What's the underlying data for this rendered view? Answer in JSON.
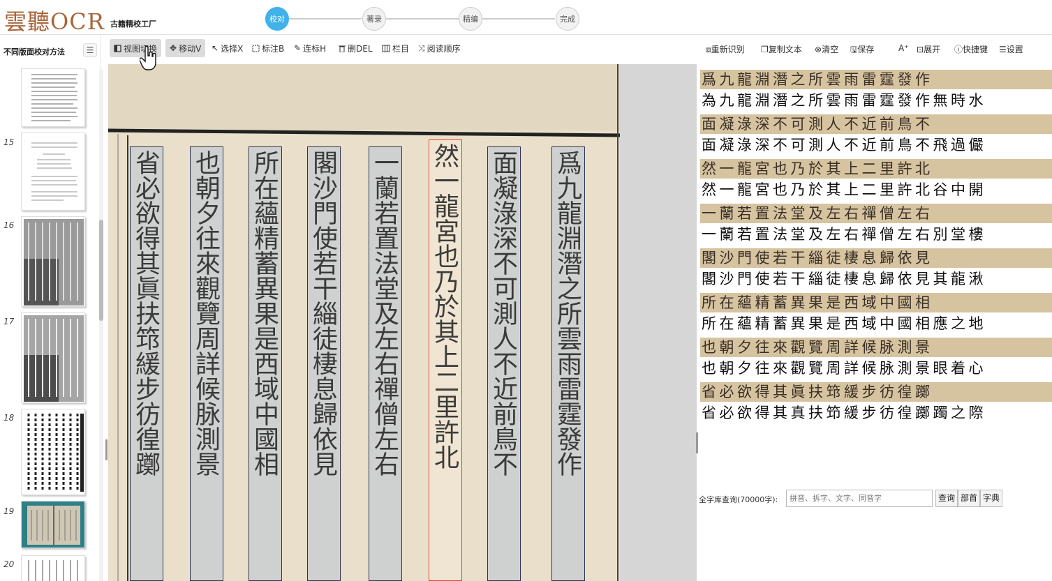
{
  "app": {
    "logo": "雲聽OCR",
    "subtitle": "古籍精校工厂"
  },
  "steps": [
    "校对",
    "著录",
    "精编",
    "完成"
  ],
  "left": {
    "doc_title": "不同版面校对方法",
    "menu_icon": "☰",
    "pages": [
      "15",
      "16",
      "17",
      "18",
      "19",
      "20"
    ]
  },
  "toolbar": [
    {
      "label": "视图切换",
      "icon": "view-switch-icon"
    },
    {
      "label": "移动V",
      "icon": "move-icon"
    },
    {
      "label": "选择X",
      "icon": "select-icon"
    },
    {
      "label": "标注B",
      "icon": "annotate-icon"
    },
    {
      "label": "连标H",
      "icon": "pen-icon"
    },
    {
      "label": "删DEL",
      "icon": "trash-icon"
    },
    {
      "label": "栏目",
      "icon": "column-icon"
    },
    {
      "label": "阅读顺序",
      "icon": "order-icon"
    }
  ],
  "right_toolbar": [
    {
      "label": "重新识别",
      "icon": "rerecognize-icon"
    },
    {
      "label": "复制文本",
      "icon": "copy-icon"
    },
    {
      "label": "清空",
      "icon": "clear-icon"
    },
    {
      "label": "保存",
      "icon": "save-icon"
    },
    {
      "label": "A⁺",
      "icon": "font-size-icon"
    },
    {
      "label": "展开",
      "icon": "expand-icon"
    },
    {
      "label": "快捷键",
      "icon": "info-icon"
    },
    {
      "label": "设置",
      "icon": "settings-icon"
    }
  ],
  "columns": [
    "爲九龍淵潛之所雲雨雷霆發作",
    "面凝淥深不可測人不近前鳥不",
    "然一龍宮也乃於其上二里許北",
    "一蘭若置法堂及左右禪僧左右",
    "閣沙門使若干緇徒棲息歸依見",
    "所在蘊精蓄異果是西域中國相",
    "也朝夕往來觀覽周詳候脉測景",
    "省必欲得其眞扶筇緩步彷徨躑"
  ],
  "lines": [
    "為九龍淵潛之所雲雨雷霆發作無時水",
    "面凝淥深不可測人不近前鳥不飛過儼",
    "然一龍宮也乃於其上二里許北谷中開",
    "一蘭若置法堂及左右禪僧左右別堂樓",
    "閣沙門使若干緇徒棲息歸依見其龍湫",
    "所在蘊精蓄異果是西域中國相應之地",
    "也朝夕往來觀覽周詳候脉測景眼着心",
    "省必欲得其真扶笻緩步彷徨躑躅之際"
  ],
  "search": {
    "label": "全字库查询(70000字):",
    "placeholder": "拼音、拆字、文字、同音字",
    "query_btn": "查询",
    "radical_btn": "部首",
    "dict_btn": "字典"
  },
  "colors": {
    "brand": "#a8653a",
    "accent": "#3fb2ea",
    "select": "#e0462b"
  }
}
